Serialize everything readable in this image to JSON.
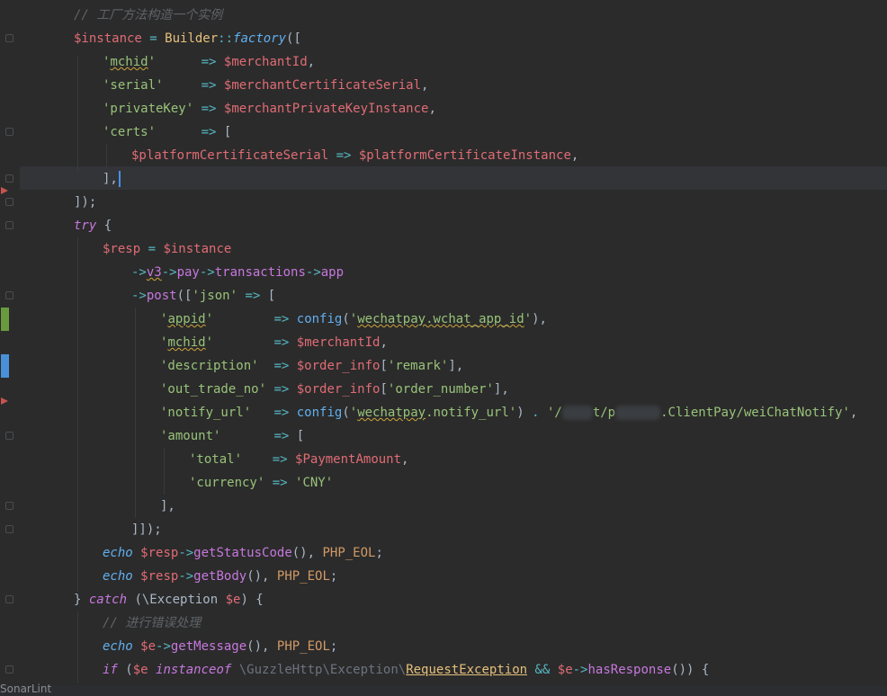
{
  "editor": {
    "lines": {
      "l1_comment": "// 工厂方法构造一个实例",
      "l2": {
        "var": "$instance",
        "eq": " = ",
        "cls": "Builder",
        "sep": "::",
        "fn": "factory",
        "rest": "(["
      },
      "l3": {
        "q1": "'",
        "key": "mchid",
        "q2": "'",
        "pad": "      ",
        "arrow": "=>",
        "sp": " ",
        "var": "$merchantId",
        "end": ","
      },
      "l4": {
        "key": "'serial'",
        "pad": "     ",
        "arrow": "=>",
        "sp": " ",
        "var": "$merchantCertificateSerial",
        "end": ","
      },
      "l5": {
        "key": "'privateKey'",
        "pad": " ",
        "arrow": "=>",
        "sp": " ",
        "var": "$merchantPrivateKeyInstance",
        "end": ","
      },
      "l6": {
        "key": "'certs'",
        "pad": "      ",
        "arrow": "=>",
        "rest": " ["
      },
      "l7": {
        "var1": "$platformCertificateSerial",
        "arrow": " => ",
        "var2": "$platformCertificateInstance",
        "end": ","
      },
      "l8": "],",
      "l9": "]);",
      "l10": {
        "kw": "try",
        "rest": " {"
      },
      "l11": {
        "var1": "$resp",
        "eq": " = ",
        "var2": "$instance"
      },
      "l12": {
        "a1": "->",
        "m1": "v3",
        "a2": "->",
        "m2": "pay",
        "a3": "->",
        "m3": "transactions",
        "a4": "->",
        "m4": "app"
      },
      "l13": {
        "a1": "->",
        "m1": "post",
        "p1": "([",
        "str": "'json'",
        "arrow": " => ",
        "p2": "["
      },
      "l14": {
        "q1": "'",
        "key": "appid",
        "q2": "'",
        "pad": "        ",
        "arrow": "=>",
        "sp": " ",
        "fn": "config",
        "p1": "(",
        "q3": "'",
        "sq": "wechatpay.wchat_app_id",
        "q4": "'",
        "p2": ")",
        "end": ","
      },
      "l15": {
        "q1": "'",
        "key": "mchid",
        "q2": "'",
        "pad": "        ",
        "arrow": "=>",
        "sp": " ",
        "var": "$merchantId",
        "end": ","
      },
      "l16": {
        "key": "'description'",
        "pad": "  ",
        "arrow": "=>",
        "sp": " ",
        "var": "$order_info",
        "p1": "[",
        "str": "'remark'",
        "p2": "]",
        "end": ","
      },
      "l17": {
        "key": "'out_trade_no'",
        "pad": " ",
        "arrow": "=>",
        "sp": " ",
        "var": "$order_info",
        "p1": "[",
        "str": "'order_number'",
        "p2": "]",
        "end": ","
      },
      "l18": {
        "key": "'notify_url'",
        "pad": "   ",
        "arrow": "=>",
        "sp": " ",
        "fn": "config",
        "p1": "(",
        "q3": "'",
        "sq": "wechatpay",
        "str2": ".notify_url'",
        "p2": ")",
        "dot": " . ",
        "s1": "'/",
        "s2": "t/p",
        "s3": ".ClientPay/weiChatNotify'",
        "end": ","
      },
      "l19": {
        "key": "'amount'",
        "pad": "       ",
        "arrow": "=>",
        "rest": " ["
      },
      "l20": {
        "key": "'total'",
        "pad": "    ",
        "arrow": "=>",
        "sp": " ",
        "var": "$PaymentAmount",
        "end": ","
      },
      "l21": {
        "key": "'currency'",
        "arrow": " => ",
        "str": "'CNY'"
      },
      "l22": "],",
      "l23": "]]);",
      "l24": {
        "kw": "echo",
        "sp": " ",
        "var": "$resp",
        "arrow": "->",
        "fn": "getStatusCode",
        "p": "(), ",
        "const": "PHP_EOL",
        "end": ";"
      },
      "l25": {
        "kw": "echo",
        "sp": " ",
        "var": "$resp",
        "arrow": "->",
        "fn": "getBody",
        "p": "(), ",
        "const": "PHP_EOL",
        "end": ";"
      },
      "l26": {
        "p1": "} ",
        "kw": "catch",
        "p2": " (\\Exception ",
        "var": "$e",
        "p3": ") {"
      },
      "l27_comment": "// 进行错误处理",
      "l28": {
        "kw": "echo",
        "sp": " ",
        "var": "$e",
        "arrow": "->",
        "fn": "getMessage",
        "p": "(), ",
        "const": "PHP_EOL",
        "end": ";"
      },
      "l29": {
        "kw": "if",
        "p1": " (",
        "var1": "$e",
        "sp": " ",
        "kw2": "instanceof",
        "ns": " \\GuzzleHttp\\Exception\\",
        "exc": "RequestException",
        "and": " && ",
        "var2": "$e",
        "arrow": "->",
        "fn": "hasResponse",
        "p2": "()) {"
      }
    }
  },
  "status_bar": {
    "label": "SonarLint"
  },
  "colors": {
    "background": "#2b2b2b",
    "current_line": "#323438",
    "added_marker": "#6a9a3e",
    "modified_marker": "#4a90d9",
    "bookmark_marker": "#c75450"
  }
}
